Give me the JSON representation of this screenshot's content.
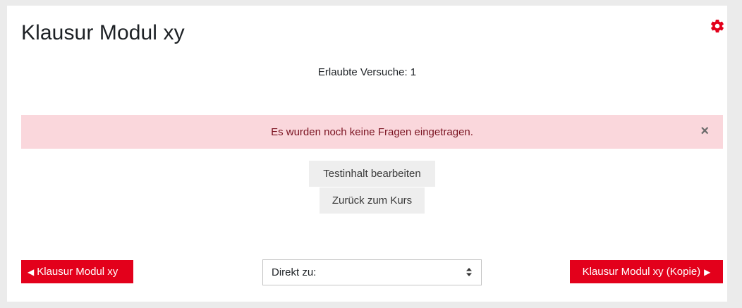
{
  "page": {
    "title": "Klausur Modul xy",
    "attempts_text": "Erlaubte Versuche: 1"
  },
  "alert": {
    "message": "Es wurden noch keine Fragen eingetragen.",
    "close_symbol": "×"
  },
  "actions": {
    "edit_label": "Testinhalt bearbeiten",
    "back_label": "Zurück zum Kurs"
  },
  "navigation": {
    "prev_label": "Klausur Modul xy",
    "prev_arrow": "◀",
    "next_label": "Klausur Modul xy (Kopie)",
    "next_arrow": "▶",
    "jump_select_value": "Direkt zu:"
  },
  "icons": {
    "settings": "gear-icon",
    "select_caret": "updown-caret-icon"
  },
  "colors": {
    "accent": "#e3001b",
    "alert_bg": "#fad7dc",
    "alert_text": "#7a1220",
    "secondary_button_bg": "#eeeeee"
  }
}
